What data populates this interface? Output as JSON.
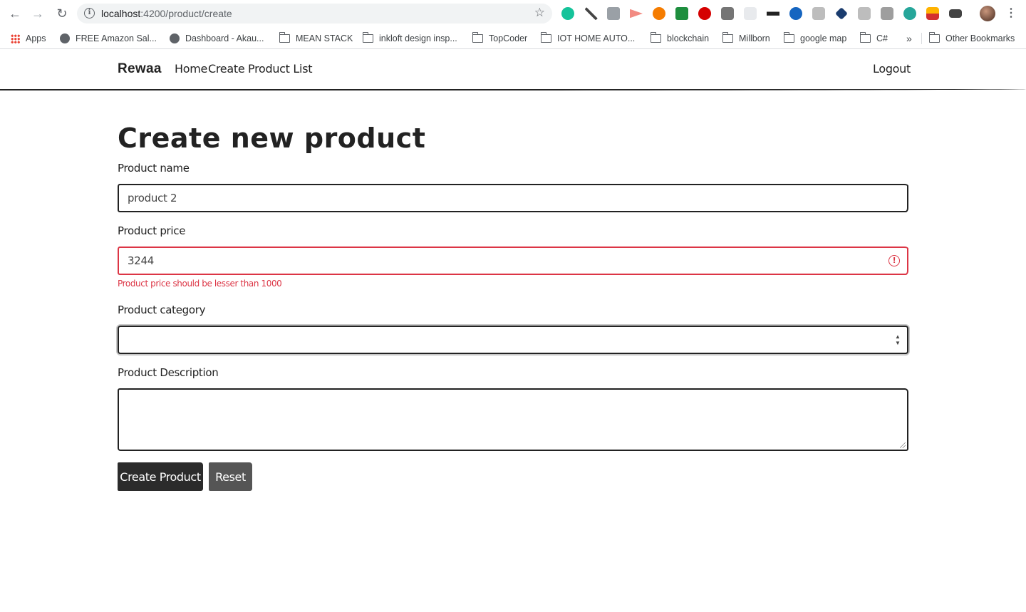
{
  "browser": {
    "url_host": "localhost",
    "url_path": ":4200/product/create",
    "bookmarks": [
      {
        "label": "Apps",
        "icon": "apps-grid-icon"
      },
      {
        "label": "FREE Amazon Sal...",
        "icon": "globe-icon"
      },
      {
        "label": "Dashboard - Akau...",
        "icon": "globe-icon"
      },
      {
        "label": "MEAN STACK",
        "icon": "folder-icon"
      },
      {
        "label": "inkloft design insp...",
        "icon": "folder-icon"
      },
      {
        "label": "TopCoder",
        "icon": "folder-icon"
      },
      {
        "label": "IOT HOME AUTO...",
        "icon": "folder-icon"
      },
      {
        "label": "blockchain",
        "icon": "folder-icon"
      },
      {
        "label": "Millborn",
        "icon": "folder-icon"
      },
      {
        "label": "google map",
        "icon": "folder-icon"
      },
      {
        "label": "C#",
        "icon": "folder-icon"
      }
    ],
    "overflow_label": "»",
    "other_bookmarks": "Other Bookmarks"
  },
  "nav": {
    "brand": "Rewaa",
    "links": [
      "Home",
      "Create",
      "Product List"
    ],
    "logout": "Logout"
  },
  "form": {
    "title": "Create new product",
    "name_label": "Product name",
    "name_value": "product 2",
    "price_label": "Product price",
    "price_value": "3244",
    "price_error": "Product price should be lesser than 1000",
    "category_label": "Product category",
    "category_value": "",
    "description_label": "Product Description",
    "description_value": "",
    "submit_label": "Create Product",
    "reset_label": "Reset"
  },
  "colors": {
    "error": "#dc3545",
    "primary_button": "#2b2b2b",
    "secondary_button": "#555555"
  }
}
